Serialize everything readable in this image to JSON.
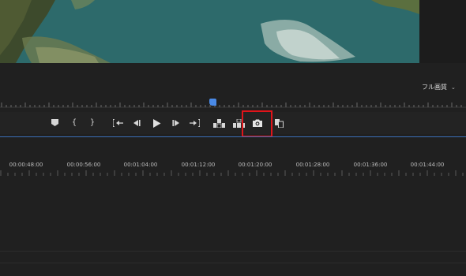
{
  "monitor": {
    "quality_label": "フル画質",
    "quality_caret": "⌄"
  },
  "transport": {
    "buttons": [
      {
        "name": "add-marker-button",
        "icon": "marker-icon"
      },
      {
        "name": "mark-in-button",
        "glyph": "{"
      },
      {
        "name": "mark-out-button",
        "glyph": "}"
      },
      {
        "name": "go-to-in-button",
        "icon": "go-to-in-icon"
      },
      {
        "name": "step-back-button",
        "icon": "step-back-icon"
      },
      {
        "name": "play-button",
        "icon": "play-icon"
      },
      {
        "name": "step-forward-button",
        "icon": "step-forward-icon"
      },
      {
        "name": "go-to-out-button",
        "icon": "go-to-out-icon"
      },
      {
        "name": "lift-button",
        "icon": "lift-icon"
      },
      {
        "name": "extract-button",
        "icon": "extract-icon"
      },
      {
        "name": "export-frame-button",
        "icon": "camera-icon"
      },
      {
        "name": "comparison-view-button",
        "icon": "comparison-icon"
      }
    ],
    "highlighted": "export-frame-button"
  },
  "timeline": {
    "timecodes": [
      "00:00:48:00",
      "00:00:56:00",
      "00:01:04:00",
      "00:01:12:00",
      "00:01:20:00",
      "00:01:28:00",
      "00:01:36:00",
      "00:01:44:00"
    ]
  },
  "colors": {
    "playhead": "#4a8ae6",
    "highlight": "#e0141a",
    "background": "#202020"
  }
}
